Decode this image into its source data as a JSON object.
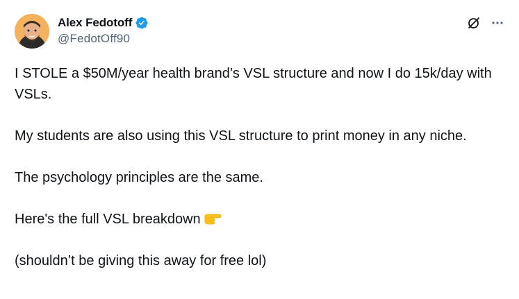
{
  "author": {
    "display_name": "Alex Fedotoff",
    "handle": "@FedotOff90",
    "verified": true
  },
  "icons": {
    "verified": "verified-badge-icon",
    "grok": "grok-icon",
    "more": "more-options-icon",
    "emoji": "backhand-index-pointing-right-emoji"
  },
  "tweet": {
    "paragraphs": [
      "I STOLE a $50M/year health brand’s VSL structure and now I do 15k/day with VSLs.",
      "My students are also using this VSL structure to print money in any niche.",
      "The psychology principles are the same.",
      "Here's the full VSL breakdown",
      "(shouldn’t be giving this away for free lol)"
    ]
  },
  "colors": {
    "text": "#0f1419",
    "secondary": "#536471",
    "verified": "#1d9bf0",
    "background": "#ffffff"
  }
}
